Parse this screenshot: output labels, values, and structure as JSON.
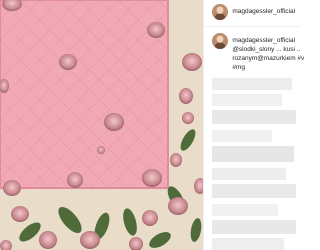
{
  "post": {
    "username": "magdagessler_official",
    "caption": {
      "line1": "@slodki_slony ... kusi ..",
      "line2": "rozanym@mazurkiem #v",
      "line3": "#mg"
    }
  },
  "colors": {
    "cake_pink": "#f2a9b6",
    "rosebud": "#c98a8f",
    "leaf": "#4f6b3a",
    "text": "#262626",
    "border": "#efefef"
  }
}
